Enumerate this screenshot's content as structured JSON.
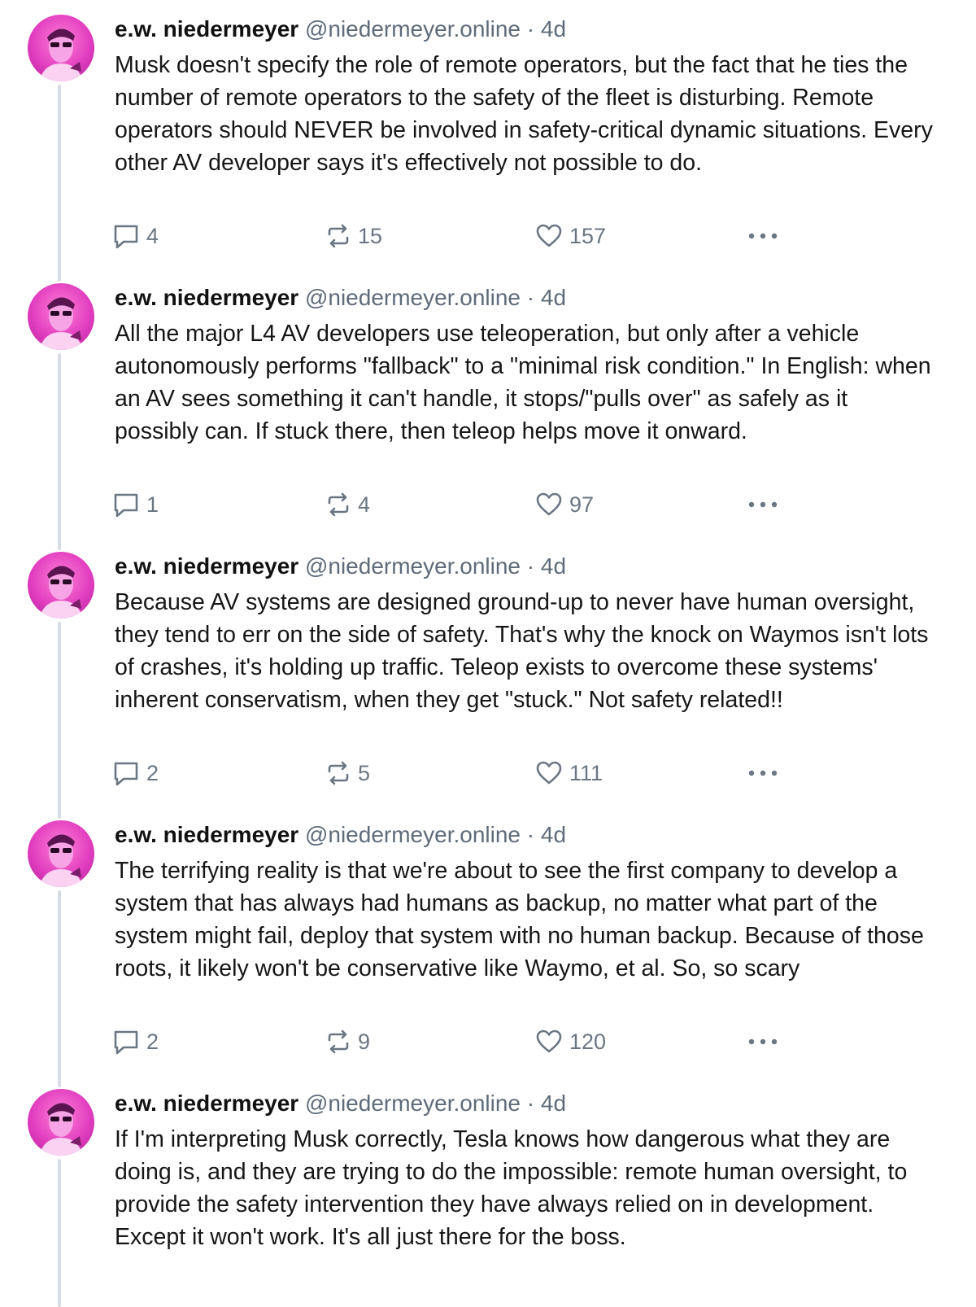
{
  "colors": {
    "rail": "#d7dde4",
    "handle_gray": "#5f6b7a",
    "icon_gray": "#6b7683",
    "avatar_pink": "#e23fc0"
  },
  "posts": [
    {
      "name": "e.w. niedermeyer",
      "handle": "@niedermeyer.online",
      "separator": "·",
      "time": "4d",
      "text": "Musk doesn't specify the role of remote operators, but the fact that he ties the number of remote operators to the safety of the fleet is disturbing. Remote operators should NEVER be involved in safety-critical dynamic situations. Every other AV developer says it's effectively not possible to do.",
      "replies": "4",
      "reposts": "15",
      "likes": "157",
      "icons": {
        "reply": "speech-bubble-icon",
        "repost": "repost-arrows-icon",
        "like": "heart-icon",
        "more": "more-dots-icon"
      }
    },
    {
      "name": "e.w. niedermeyer",
      "handle": "@niedermeyer.online",
      "separator": "·",
      "time": "4d",
      "text": "All the major L4 AV developers use teleoperation, but only after a vehicle autonomously performs \"fallback\" to a \"minimal risk condition.\" In English: when an AV sees something it can't handle, it stops/\"pulls over\" as safely as it possibly can. If stuck there, then teleop helps move it onward.",
      "replies": "1",
      "reposts": "4",
      "likes": "97",
      "icons": {
        "reply": "speech-bubble-icon",
        "repost": "repost-arrows-icon",
        "like": "heart-icon",
        "more": "more-dots-icon"
      }
    },
    {
      "name": "e.w. niedermeyer",
      "handle": "@niedermeyer.online",
      "separator": "·",
      "time": "4d",
      "text": "Because AV systems are designed ground-up to never have human oversight, they tend to err on the side of safety. That's why the knock on Waymos isn't lots of crashes, it's holding up traffic. Teleop exists to overcome these systems' inherent conservatism, when they get \"stuck.\" Not safety related!!",
      "replies": "2",
      "reposts": "5",
      "likes": "111",
      "icons": {
        "reply": "speech-bubble-icon",
        "repost": "repost-arrows-icon",
        "like": "heart-icon",
        "more": "more-dots-icon"
      }
    },
    {
      "name": "e.w. niedermeyer",
      "handle": "@niedermeyer.online",
      "separator": "·",
      "time": "4d",
      "text": "The terrifying reality is that we're about to see the first company to develop a system that has always had humans as backup, no matter what part of the system might fail, deploy that system with no human backup. Because of those roots, it likely won't be conservative like Waymo, et al. So, so scary",
      "replies": "2",
      "reposts": "9",
      "likes": "120",
      "icons": {
        "reply": "speech-bubble-icon",
        "repost": "repost-arrows-icon",
        "like": "heart-icon",
        "more": "more-dots-icon"
      }
    },
    {
      "name": "e.w. niedermeyer",
      "handle": "@niedermeyer.online",
      "separator": "·",
      "time": "4d",
      "text": "If I'm interpreting Musk correctly, Tesla knows how dangerous what they are doing is, and they are trying to do the impossible: remote human oversight, to provide the safety intervention they have always relied on in development. Except it won't work. It's all just there for the boss.",
      "icons": {
        "reply": "speech-bubble-icon",
        "repost": "repost-arrows-icon",
        "like": "heart-icon",
        "more": "more-dots-icon"
      }
    }
  ]
}
